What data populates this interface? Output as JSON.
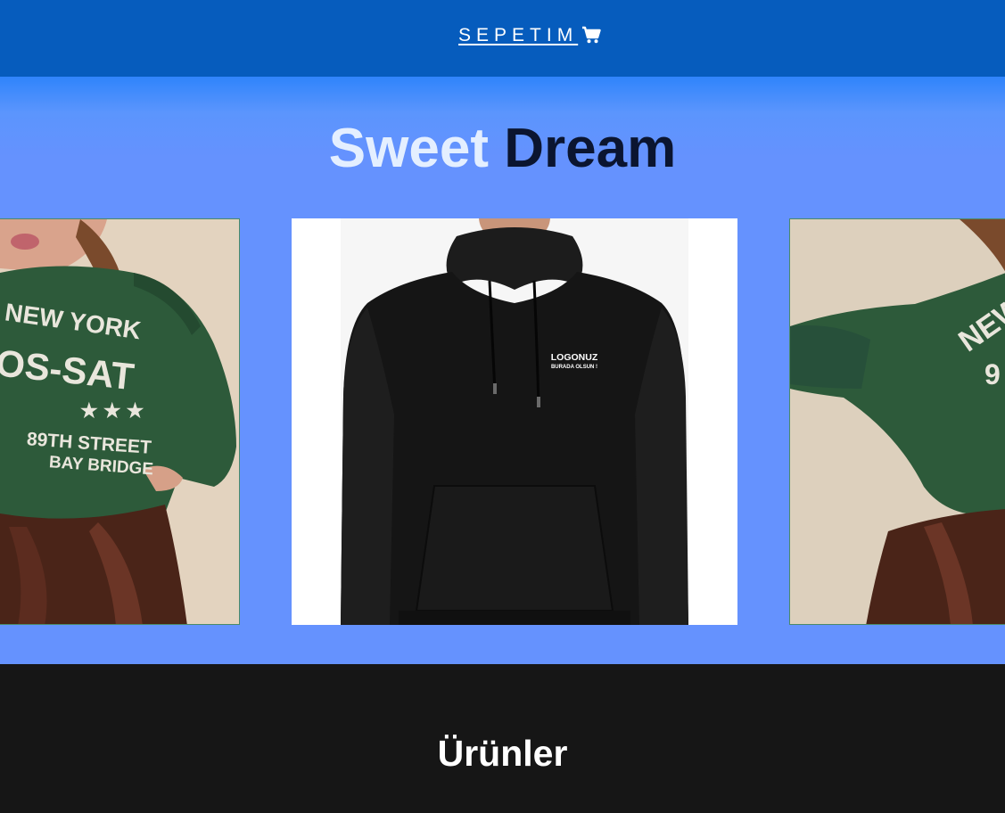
{
  "header": {
    "cart_label": "SEPETIM",
    "cart_icon": "shopping-cart-icon",
    "background_color": "#065cbd"
  },
  "hero": {
    "brand_word_1": "Sweet",
    "brand_word_2": "Dream",
    "background_color": "#6592fe"
  },
  "carousel": {
    "slides": [
      {
        "name": "green-new-york-sweatshirt",
        "print_lines": [
          "NEW YORK",
          "OS-SAT",
          "89TH STREET",
          "BAY BRIDGE"
        ]
      },
      {
        "name": "black-hoodie",
        "print_lines": [
          "LOGONUZ",
          "BURADA OLSUN !"
        ]
      },
      {
        "name": "green-new-york-sweatshirt-back",
        "print_lines": [
          "NEW",
          "9"
        ]
      }
    ]
  },
  "products": {
    "title": "Ürünler",
    "background_color": "#161616"
  }
}
